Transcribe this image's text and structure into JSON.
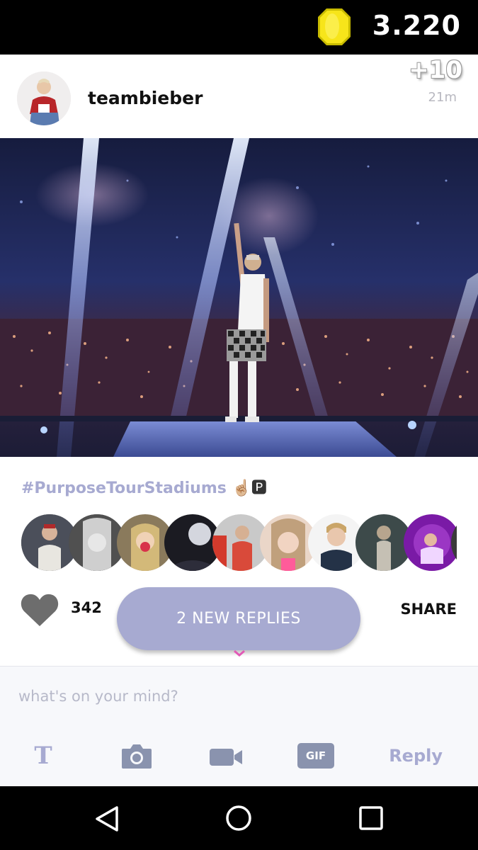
{
  "status": {
    "coin_icon": "coin-icon",
    "coin_count": "3.220"
  },
  "post": {
    "username": "teambieber",
    "points": "+10",
    "time": "21m",
    "caption": "#PurposeTourStadiums",
    "caption_emoji": "☝🏼🅿",
    "likes": "342",
    "new_replies_label": "2 NEW REPLIES",
    "share_label": "SHARE"
  },
  "composer": {
    "placeholder": "what's on your mind?",
    "tools": [
      "text-icon",
      "camera-icon",
      "video-icon",
      "gif-icon"
    ],
    "gif_label": "GIF",
    "text_label": "T",
    "reply_label": "Reply"
  },
  "nav": {
    "items": [
      "back-icon",
      "home-icon",
      "recents-icon"
    ]
  },
  "colors": {
    "accent": "#a7aad1",
    "coin": "#f7e51a",
    "text_dark": "#111111"
  }
}
